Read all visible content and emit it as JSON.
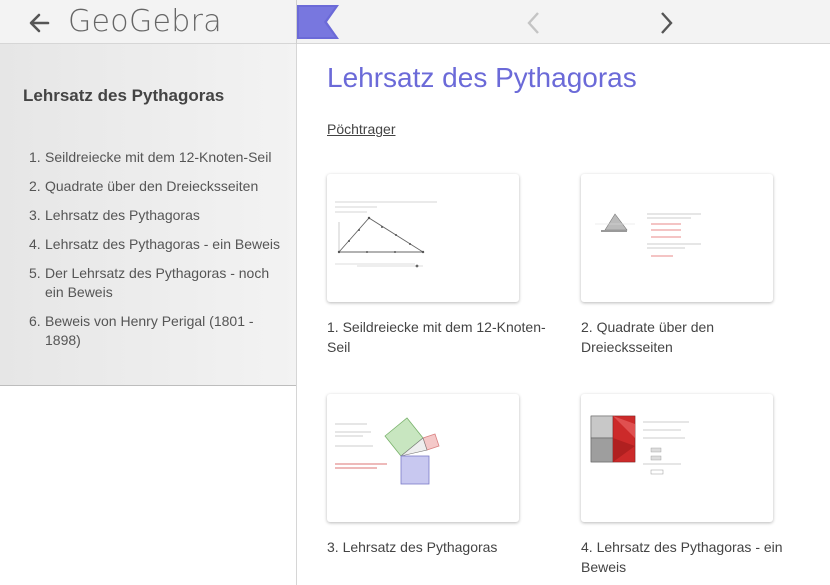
{
  "app": {
    "logo_text": "GeoGebra"
  },
  "sidebar": {
    "title": "Lehrsatz des Pythagoras",
    "items": [
      {
        "num": "1.",
        "label": "Seildreiecke mit dem 12-Knoten-Seil"
      },
      {
        "num": "2.",
        "label": "Quadrate über den Dreiecksseiten"
      },
      {
        "num": "3.",
        "label": "Lehrsatz des Pythagoras"
      },
      {
        "num": "4.",
        "label": "Lehrsatz des Pythagoras - ein Beweis"
      },
      {
        "num": "5.",
        "label": "Der Lehrsatz des Pythagoras - noch ein Beweis"
      },
      {
        "num": "6.",
        "label": "Beweis von Henry Perigal (1801 - 1898)"
      }
    ]
  },
  "main": {
    "title": "Lehrsatz des Pythagoras",
    "author": "Pöchtrager",
    "cards": [
      {
        "caption": "1. Seildreiecke mit dem 12-Knoten-Seil",
        "thumbnail": "rope-triangle-thumbnail"
      },
      {
        "caption": "2. Quadrate über den Dreiecksseiten",
        "thumbnail": "squares-on-sides-thumbnail"
      },
      {
        "caption": "3. Lehrsatz des Pythagoras",
        "thumbnail": "pythagoras-squares-thumbnail"
      },
      {
        "caption": "4. Lehrsatz des Pythagoras - ein Beweis",
        "thumbnail": "proof-squares-thumbnail"
      }
    ]
  },
  "colors": {
    "accent": "#6b6ad8",
    "topbar_bg": "#f3f3f3",
    "sidebar_bg": "#ececec",
    "text": "#444444"
  }
}
